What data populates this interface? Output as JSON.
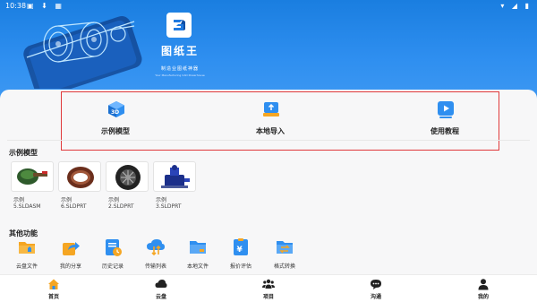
{
  "status_bar": {
    "time": "10:38",
    "left_icons": "▣ ⬇ ▦",
    "right_icons": "▾ ◢ ▮"
  },
  "banner": {
    "app_name": "图纸王",
    "slogan": "制造业图纸神器",
    "slogan_en": "Your Manufacturing CAD Powerhouse"
  },
  "quick_actions": [
    {
      "label": "示例模型",
      "icon": "3d-box-icon"
    },
    {
      "label": "本地导入",
      "icon": "import-icon"
    },
    {
      "label": "使用教程",
      "icon": "play-video-icon"
    }
  ],
  "sample_section": {
    "title": "示例模型",
    "models": [
      {
        "category": "示例",
        "name": "5.SLDASM"
      },
      {
        "category": "示例",
        "name": "6.SLDPRT"
      },
      {
        "category": "示例",
        "name": "2.SLDPRT"
      },
      {
        "category": "示例",
        "name": "3.SLDPRT"
      }
    ]
  },
  "other_section": {
    "title": "其他功能",
    "items": [
      {
        "label": "云盘文件",
        "icon": "cloud-folder-icon"
      },
      {
        "label": "我的分享",
        "icon": "share-icon"
      },
      {
        "label": "历史记录",
        "icon": "history-icon"
      },
      {
        "label": "传输列表",
        "icon": "transfer-icon"
      },
      {
        "label": "本地文件",
        "icon": "local-folder-icon"
      },
      {
        "label": "报价评估",
        "icon": "quote-icon"
      },
      {
        "label": "格式转换",
        "icon": "convert-icon"
      }
    ]
  },
  "bottom_nav": [
    {
      "label": "首页",
      "icon": "home-icon"
    },
    {
      "label": "云盘",
      "icon": "cloud-icon"
    },
    {
      "label": "项目",
      "icon": "team-icon"
    },
    {
      "label": "沟通",
      "icon": "chat-icon"
    },
    {
      "label": "我的",
      "icon": "user-icon"
    }
  ],
  "colors": {
    "brand_blue": "#2f8ff0",
    "highlight_red": "#e0393b",
    "orange": "#f5a623"
  }
}
